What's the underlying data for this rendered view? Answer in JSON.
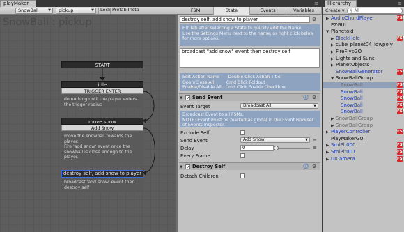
{
  "playmaker": {
    "tab_title": "playMaker",
    "toolbar": {
      "gameobject": "SnowBall",
      "fsm": "pickup",
      "lock": "Lock",
      "prefab": "Prefab Insta"
    },
    "graph_title": "SnowBall : pickup",
    "states": {
      "start": {
        "title": "START"
      },
      "idle": {
        "title": "idle",
        "event": "TRIGGER ENTER",
        "description": "do nothing until the player enters the trigger radius"
      },
      "move": {
        "title": "move snow",
        "event": "Add Snow",
        "description": "move the snowball towards the player.\nFire 'add snow' event once the snowball is close enough to the player."
      },
      "destroy": {
        "title": "destroy self, add snow to player",
        "description": "broadcast 'add snow' event then destroy self"
      }
    }
  },
  "inspector": {
    "tabs": [
      "FSM",
      "State",
      "Events",
      "Variables"
    ],
    "active_tab": "State",
    "state_name": "destroy self, add snow to player",
    "name_hint": "Hit Tab after selecting a State to quickly edit the Name.\nUse the Settings Menu next to the name, or right click below for more options.",
    "state_description": "broadcast \"add snow\" event then destroy self",
    "shortcuts_hint": "Edit Action Name      Double Click Action Title\nOpen/Close All         Cmd Click Foldout\nEnable/Disable All   Cmd Click Enable Checkbox",
    "send_event": {
      "title": "Send Event",
      "event_target_label": "Event Target",
      "event_target_value": "Broadcast All",
      "hint": "Broadcast Event to all FSMs.\nNOTE: Event must be marked as global in the Event Browser of Events Inspector.",
      "exclude_self_label": "Exclude Self",
      "send_event_label": "Send Event",
      "send_event_value": "Add Snow",
      "delay_label": "Delay",
      "delay_value": "0",
      "every_frame_label": "Every Frame"
    },
    "destroy_self": {
      "title": "Destroy Self",
      "detach_children_label": "Detach Children"
    }
  },
  "hierarchy": {
    "tab_title": "Hierarchy",
    "create_label": "Create",
    "search_placeholder": "All",
    "items": [
      {
        "label": "AudioChordPlayer",
        "color": "blue",
        "fold": "right",
        "depth": 0,
        "badge": true
      },
      {
        "label": "EZGUI",
        "color": "black",
        "fold": "",
        "depth": 0,
        "badge": false
      },
      {
        "label": "Planetoid",
        "color": "black",
        "fold": "down",
        "depth": 0,
        "badge": false
      },
      {
        "label": "BlackHole",
        "color": "blue",
        "fold": "right",
        "depth": 1,
        "badge": true
      },
      {
        "label": "cube_planet04_lowpoly",
        "color": "black",
        "fold": "right",
        "depth": 1,
        "badge": false
      },
      {
        "label": "FireFlysGO",
        "color": "black",
        "fold": "right",
        "depth": 1,
        "badge": false
      },
      {
        "label": "Lights and Suns",
        "color": "black",
        "fold": "right",
        "depth": 1,
        "badge": false
      },
      {
        "label": "PlanetObjects",
        "color": "black",
        "fold": "right",
        "depth": 1,
        "badge": false
      },
      {
        "label": "SnowBallGenerator",
        "color": "blue",
        "fold": "",
        "depth": 1,
        "badge": true
      },
      {
        "label": "SnowBallGroup",
        "color": "black",
        "fold": "down",
        "depth": 1,
        "badge": false
      },
      {
        "label": "SnowBall",
        "color": "gray",
        "fold": "",
        "depth": 2,
        "badge": true,
        "selected": true
      },
      {
        "label": "SnowBall",
        "color": "blue",
        "fold": "",
        "depth": 2,
        "badge": true
      },
      {
        "label": "SnowBall",
        "color": "blue",
        "fold": "",
        "depth": 2,
        "badge": true
      },
      {
        "label": "SnowBall",
        "color": "blue",
        "fold": "",
        "depth": 2,
        "badge": true
      },
      {
        "label": "SnowBall",
        "color": "blue",
        "fold": "",
        "depth": 2,
        "badge": true
      },
      {
        "label": "SnowBallGroup",
        "color": "gray",
        "fold": "right",
        "depth": 1,
        "badge": false
      },
      {
        "label": "SnowBallGroup",
        "color": "gray",
        "fold": "right",
        "depth": 1,
        "badge": false
      },
      {
        "label": "PlayerController",
        "color": "blue",
        "fold": "right",
        "depth": 0,
        "badge": true
      },
      {
        "label": "PlayMakerGUI",
        "color": "black",
        "fold": "",
        "depth": 0,
        "badge": false
      },
      {
        "label": "SmlPlt000",
        "color": "blue",
        "fold": "right",
        "depth": 0,
        "badge": true
      },
      {
        "label": "SmlPlt001",
        "color": "blue",
        "fold": "right",
        "depth": 0,
        "badge": true
      },
      {
        "label": "UICamera",
        "color": "blue",
        "fold": "right",
        "depth": 0,
        "badge": true
      }
    ],
    "badge_text": "FSM"
  }
}
